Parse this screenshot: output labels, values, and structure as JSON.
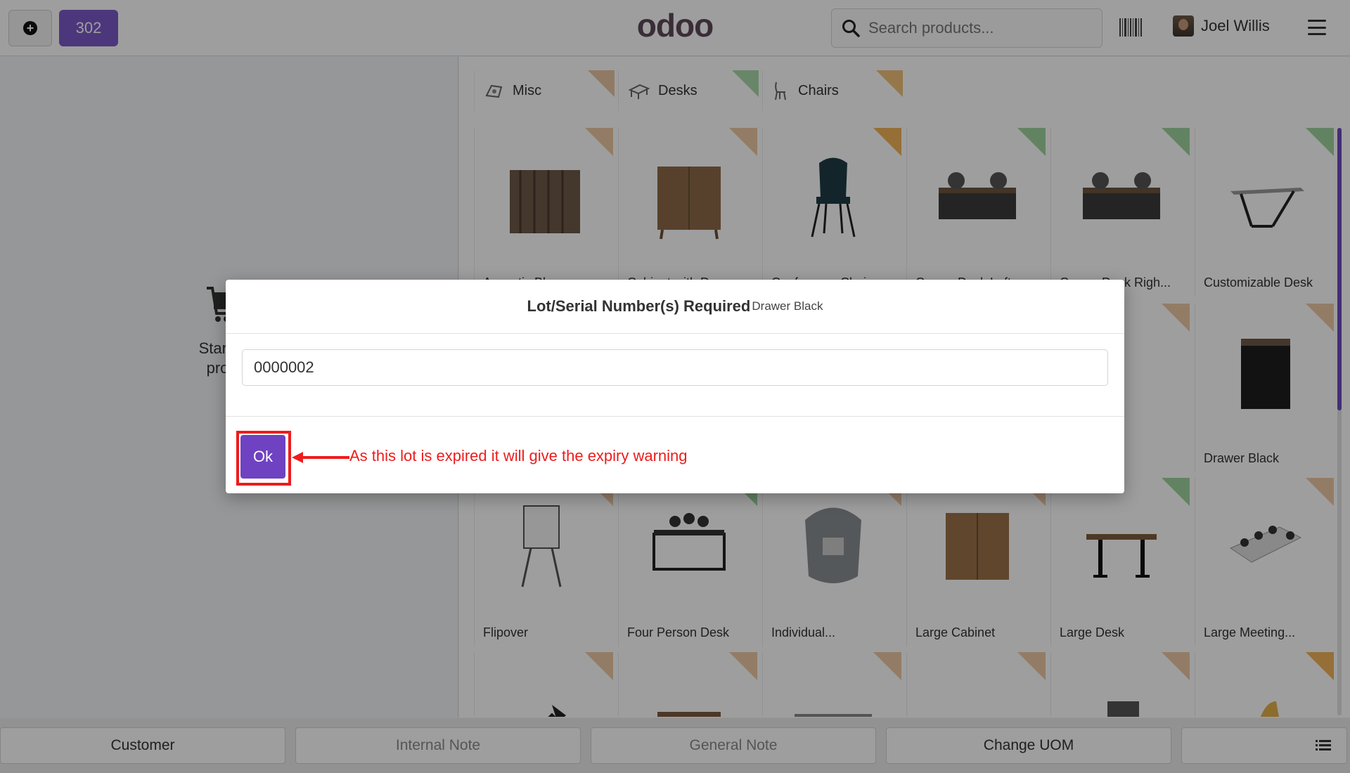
{
  "topbar": {
    "order_number": "302",
    "logo_text": "odoo",
    "search_placeholder": "Search products...",
    "user_name": "Joel Willis"
  },
  "left_pane": {
    "empty_text_line1": "Start a",
    "empty_text_line2": "proc"
  },
  "categories": [
    {
      "label": "Misc",
      "icon": "misc-icon",
      "ribbon_color": "#e8c6a4"
    },
    {
      "label": "Desks",
      "icon": "desk-icon",
      "ribbon_color": "#a8d9a8"
    },
    {
      "label": "Chairs",
      "icon": "chair-icon",
      "ribbon_color": "#f0c07a"
    }
  ],
  "products": [
    {
      "name": "Acoustic Bloc...",
      "ribbon": "beige"
    },
    {
      "name": "Cabinet with Doors",
      "ribbon": "beige"
    },
    {
      "name": "Conference Chair...",
      "ribbon": "orange"
    },
    {
      "name": "Corner Desk Left...",
      "ribbon": "green"
    },
    {
      "name": "Corner Desk Righ...",
      "ribbon": "green"
    },
    {
      "name": "Customizable Desk",
      "ribbon": "green"
    },
    {
      "name": "Drawer Black",
      "ribbon": "beige"
    },
    {
      "name": "Flipover",
      "ribbon": "beige"
    },
    {
      "name": "Four Person Desk",
      "ribbon": "green"
    },
    {
      "name": "Individual...",
      "ribbon": "beige"
    },
    {
      "name": "Large Cabinet",
      "ribbon": "beige"
    },
    {
      "name": "Large Desk",
      "ribbon": "green"
    },
    {
      "name": "Large Meeting...",
      "ribbon": "beige"
    }
  ],
  "bottom_bar": {
    "customer": "Customer",
    "internal_note": "Internal Note",
    "general_note": "General Note",
    "change_uom": "Change UOM"
  },
  "modal": {
    "title": "Lot/Serial Number(s) Required",
    "product": "Drawer Black",
    "lot_value": "0000002",
    "ok_label": "Ok",
    "annotation": "As this lot is expired it will give the expiry warning"
  },
  "colors": {
    "brand_purple": "#6f42c1",
    "annotation_red": "#ee1c1c"
  }
}
